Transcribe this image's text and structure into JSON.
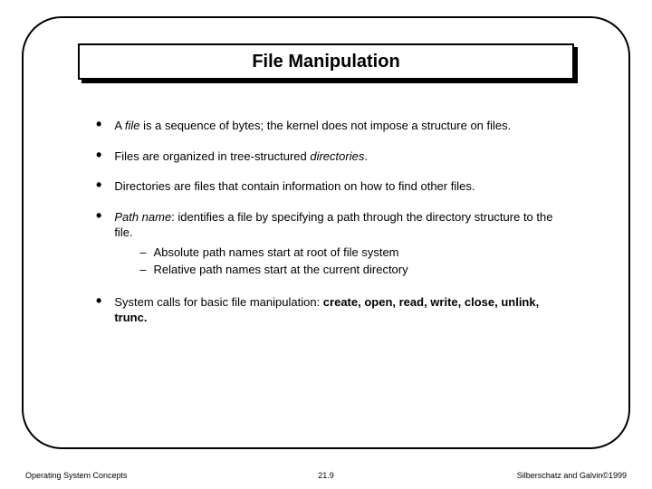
{
  "title": "File Manipulation",
  "bullets": {
    "b1_pre": "A ",
    "b1_em": "file",
    "b1_post": " is a sequence of bytes; the kernel does not impose a structure on files.",
    "b2_pre": "Files are organized in tree-structured ",
    "b2_em": "directories",
    "b2_post": ".",
    "b3": "Directories are files that contain information on how to find other files.",
    "b4_em": "Path name",
    "b4_post": ":  identifies a file by specifying a path through the directory structure to the file.",
    "b4_sub1": "Absolute path names start at root of file system",
    "b4_sub2": "Relative path names start at the current directory",
    "b5_pre": "System calls for basic file manipulation:  ",
    "b5_bold": "create, open, read, write, close, unlink, trunc."
  },
  "footer": {
    "left": "Operating System Concepts",
    "center": "21.9",
    "right": "Silberschatz and Galvin©1999"
  }
}
